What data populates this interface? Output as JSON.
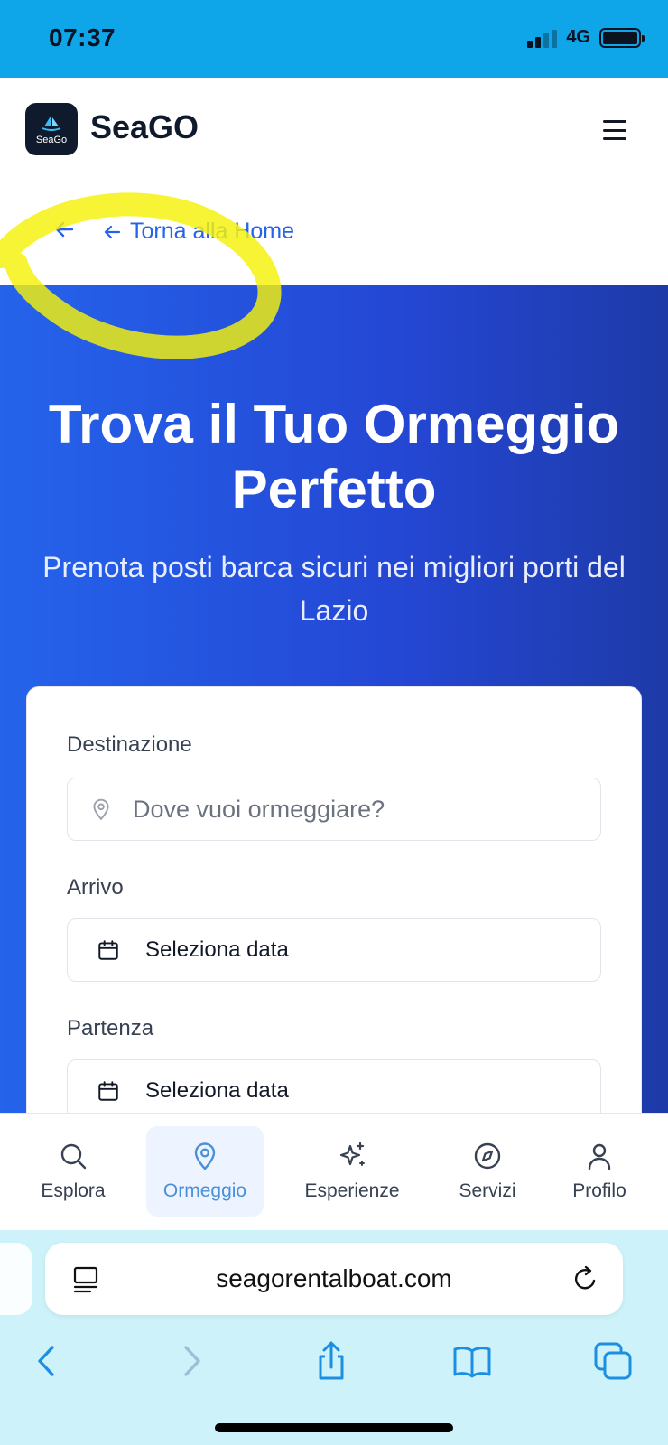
{
  "status_bar": {
    "time": "07:37",
    "network": "4G"
  },
  "header": {
    "logo_text": "SeaGo",
    "brand": "SeaGO"
  },
  "back_link": {
    "label": "Torna alla Home"
  },
  "hero": {
    "title": "Trova il Tuo Ormeggio Perfetto",
    "subtitle": "Prenota posti barca sicuri nei migliori porti del Lazio"
  },
  "form": {
    "destination_label": "Destinazione",
    "destination_placeholder": "Dove vuoi ormeggiare?",
    "arrival_label": "Arrivo",
    "arrival_value": "Seleziona data",
    "departure_label": "Partenza",
    "departure_value": "Seleziona data"
  },
  "bottom_nav": {
    "items": [
      {
        "label": "Esplora",
        "icon": "search-icon"
      },
      {
        "label": "Ormeggio",
        "icon": "map-pin-icon",
        "active": true
      },
      {
        "label": "Esperienze",
        "icon": "sparkles-icon"
      },
      {
        "label": "Servizi",
        "icon": "compass-icon"
      },
      {
        "label": "Profilo",
        "icon": "user-icon"
      }
    ]
  },
  "browser": {
    "url": "seagorentalboat.com"
  },
  "colors": {
    "accent": "#2563eb",
    "status_bar": "#0ea5e9",
    "highlight": "#f5f20a",
    "active_nav": "#4a90d9"
  }
}
